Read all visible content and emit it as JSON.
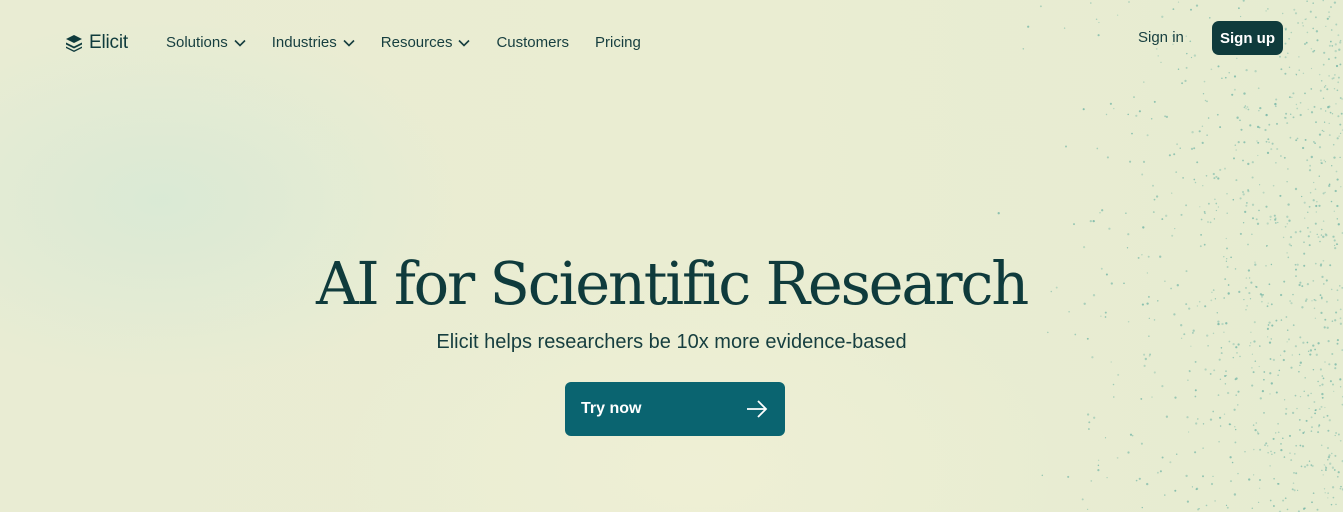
{
  "brand": {
    "name": "Elicit",
    "icon": "elicit-logo-icon"
  },
  "nav": {
    "items": [
      {
        "label": "Solutions",
        "has_dropdown": true
      },
      {
        "label": "Industries",
        "has_dropdown": true
      },
      {
        "label": "Resources",
        "has_dropdown": true
      },
      {
        "label": "Customers",
        "has_dropdown": false
      },
      {
        "label": "Pricing",
        "has_dropdown": false
      }
    ],
    "sign_in": "Sign in",
    "sign_up": "Sign up"
  },
  "hero": {
    "title": "AI for Scientific Research",
    "subtitle": "Elicit helps researchers be 10x more evidence-based",
    "cta_label": "Try now",
    "cta_icon": "arrow-right-icon"
  },
  "colors": {
    "background": "#ebedd2",
    "text": "#0f3b3c",
    "signup_bg": "#0f3b3c",
    "cta_bg": "#0a6470",
    "stipple": "#6fb3a4"
  }
}
